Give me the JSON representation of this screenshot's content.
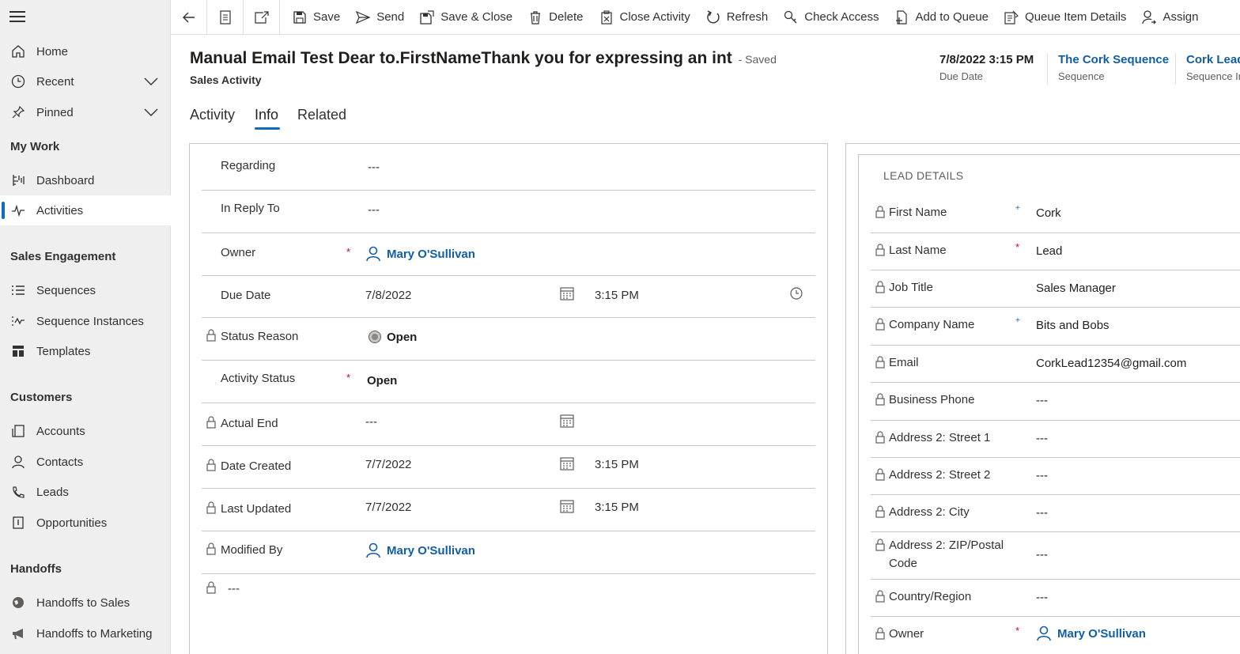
{
  "sidebar": {
    "items": [
      {
        "label": "Home"
      },
      {
        "label": "Recent"
      },
      {
        "label": "Pinned"
      },
      {
        "label": "Dashboard"
      },
      {
        "label": "Activities"
      },
      {
        "label": "Sequences"
      },
      {
        "label": "Sequence Instances"
      },
      {
        "label": "Templates"
      },
      {
        "label": "Accounts"
      },
      {
        "label": "Contacts"
      },
      {
        "label": "Leads"
      },
      {
        "label": "Opportunities"
      },
      {
        "label": "Handoffs to Sales"
      },
      {
        "label": "Handoffs to Marketing"
      }
    ],
    "groups": {
      "my_work": "My Work",
      "sales_engagement": "Sales Engagement",
      "customers": "Customers",
      "handoffs": "Handoffs"
    },
    "active_item": "Activities"
  },
  "commandbar": {
    "save": "Save",
    "send": "Send",
    "save_close": "Save & Close",
    "delete": "Delete",
    "close_activity": "Close Activity",
    "refresh": "Refresh",
    "check_access": "Check Access",
    "add_to_queue": "Add to Queue",
    "queue_item_details": "Queue Item Details",
    "assign": "Assign"
  },
  "header": {
    "title": "Manual Email Test  Dear to.FirstNameThank you for expressing an int",
    "saved": "- Saved",
    "entity": "Sales Activity",
    "fields": [
      {
        "value": "7/8/2022 3:15 PM",
        "label": "Due Date"
      },
      {
        "value": "The Cork Sequence",
        "label": "Sequence"
      },
      {
        "value": "Cork Lead",
        "label": "Sequence In"
      }
    ]
  },
  "tabs": [
    {
      "label": "Activity"
    },
    {
      "label": "Info"
    },
    {
      "label": "Related"
    }
  ],
  "active_tab": "Info",
  "form": {
    "regarding": {
      "label": "Regarding",
      "value": "---"
    },
    "in_reply_to": {
      "label": "In Reply To",
      "value": "---"
    },
    "owner": {
      "label": "Owner",
      "required": "*",
      "value": "Mary O'Sullivan"
    },
    "due_date": {
      "label": "Due Date",
      "date": "7/8/2022",
      "time": "3:15 PM"
    },
    "status_reason": {
      "label": "Status Reason",
      "value": "Open"
    },
    "activity_status": {
      "label": "Activity Status",
      "required": "*",
      "value": "Open"
    },
    "actual_end": {
      "label": "Actual End",
      "value": "---"
    },
    "date_created": {
      "label": "Date Created",
      "date": "7/7/2022",
      "time": "3:15 PM"
    },
    "last_updated": {
      "label": "Last Updated",
      "date": "7/7/2022",
      "time": "3:15 PM"
    },
    "modified_by": {
      "label": "Modified By",
      "value": "Mary O'Sullivan"
    },
    "extra": {
      "value": "---"
    }
  },
  "lead_details": {
    "title": "LEAD DETAILS",
    "rows": [
      {
        "label": "First Name",
        "value": "Cork"
      },
      {
        "label": "Last Name",
        "required": "*",
        "value": "Lead"
      },
      {
        "label": "Job Title",
        "value": "Sales Manager"
      },
      {
        "label": "Company Name",
        "value": "Bits and Bobs"
      },
      {
        "label": "Email",
        "value": "CorkLead12354@gmail.com"
      },
      {
        "label": "Business Phone",
        "value": "---"
      },
      {
        "label": "Address 2: Street 1",
        "value": "---"
      },
      {
        "label": "Address 2: Street 2",
        "value": "---"
      },
      {
        "label": "Address 2: City",
        "value": "---"
      },
      {
        "label": "Address 2: ZIP/Postal Code",
        "value": "---"
      },
      {
        "label": "Country/Region",
        "value": "---"
      },
      {
        "label": "Owner",
        "required": "*",
        "value": "Mary O'Sullivan"
      }
    ],
    "recommended_mark": "+"
  },
  "colors": {
    "accent": "#0f6cbd",
    "link": "#115ea3",
    "required": "#c50f1f",
    "sidebar_bg": "#efefef"
  }
}
